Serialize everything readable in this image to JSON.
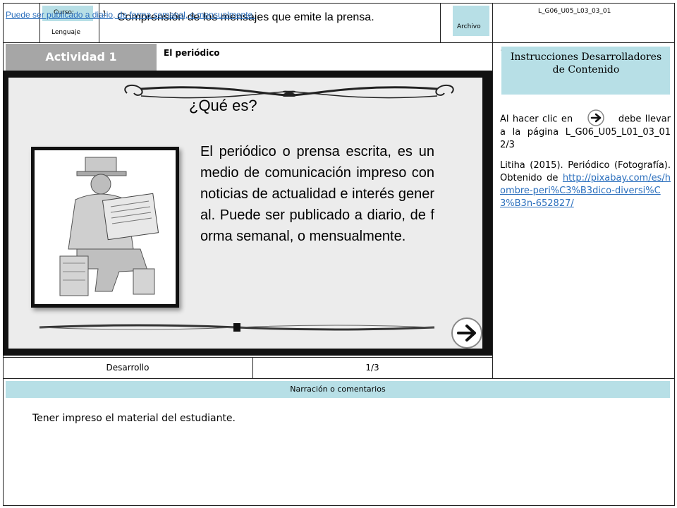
{
  "header": {
    "curso_label": "Curso:",
    "grade": "1",
    "subject": "Lenguaje",
    "title": "Comprensión de los mensajes que emite la prensa.",
    "archivo_label": "Archivo",
    "code": "L_G06_U05_L03_03_01",
    "overlay_link": "Puede ser publicado a diario, de forma semanal, o mensualmente."
  },
  "activity": {
    "badge": "Actividad 1",
    "subtitle": "El periódico"
  },
  "card": {
    "heading": "¿Qué es?",
    "paragraph": "El periódico o prensa escrita, es un medio de comunicación impreso con noticias de actualidad e interés general. Puede ser publicado a diario, de forma semanal, o mensualmente."
  },
  "sidebar": {
    "title": "Instrucciones Desarrolladores de Contenido",
    "instruction_before": "Al hacer clic en",
    "instruction_after": "debe llevar a la página L_G06_U05_L01_03_01 2/3",
    "credit_text": "Litiha (2015). Periódico (Fotografía). Obtenido de",
    "credit_link": "http://pixabay.com/es/hombre-peri%C3%B3dico-diversi%C3%B3n-652827/",
    "dash": "-"
  },
  "footer_row": {
    "section": "Desarrollo",
    "page": "1/3"
  },
  "narration": {
    "header": "Narración o comentarios",
    "text": "Tener impreso el material del estudiante."
  },
  "colors": {
    "cyan": "#b7dfe6",
    "gray_badge": "#a6a6a6",
    "link": "#2b6fbd"
  }
}
